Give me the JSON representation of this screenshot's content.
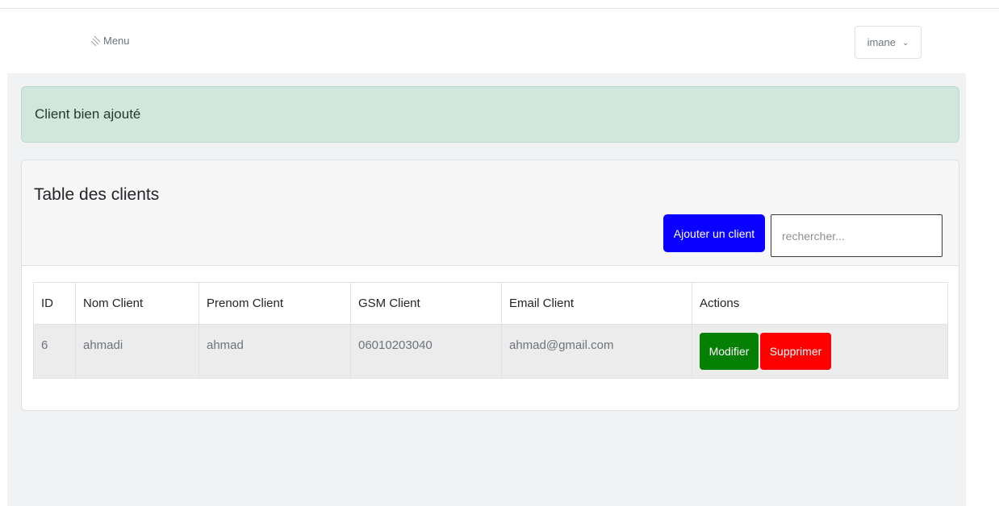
{
  "navbar": {
    "menu_label": "Menu",
    "menu_icon": "menu-lines-icon",
    "user_name": "imane",
    "user_chevron": "chevron-down-icon"
  },
  "alert": {
    "message": "Client bien ajouté",
    "color": "#d1e7dd"
  },
  "card": {
    "title": "Table des clients",
    "add_button_label": "Ajouter un client",
    "search_placeholder": "rechercher..."
  },
  "table": {
    "columns": [
      "ID",
      "Nom Client",
      "Prenom Client",
      "GSM Client",
      "Email Client",
      "Actions"
    ],
    "rows": [
      {
        "id": "6",
        "nom": "ahmadi",
        "prenom": "ahmad",
        "gsm": "06010203040",
        "email": "ahmad@gmail.com",
        "edit_label": "Modifier",
        "delete_label": "Supprimer"
      }
    ]
  },
  "colors": {
    "primary": "#0a00ff",
    "success": "#058005",
    "danger": "#ff0000",
    "background": "#f1f2f4"
  }
}
